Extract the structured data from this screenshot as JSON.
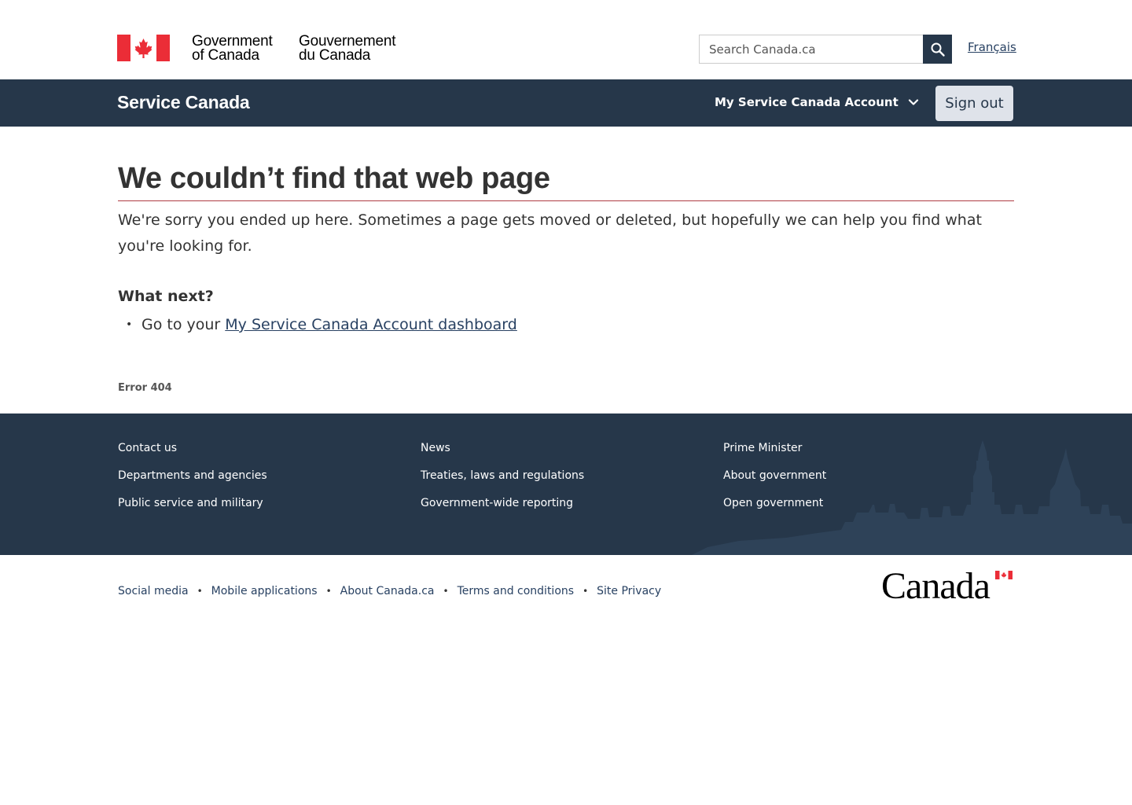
{
  "header": {
    "gov_en_line1": "Government",
    "gov_en_line2": "of Canada",
    "gov_fr_line1": "Gouvernement",
    "gov_fr_line2": "du Canada",
    "search_placeholder": "Search Canada.ca",
    "language_link": "Français"
  },
  "service_bar": {
    "title": "Service Canada",
    "account_menu": "My Service Canada Account",
    "signout_label": "Sign out"
  },
  "main": {
    "title": "We couldn’t find that web page",
    "intro": "We're sorry you ended up here. Sometimes a page gets moved or deleted, but hopefully we can help you find what you're looking for.",
    "next_heading": "What next?",
    "next_items": [
      {
        "prefix": "Go to your ",
        "link": "My Service Canada Account dashboard"
      }
    ],
    "error_code": "Error 404"
  },
  "footer": {
    "columns": [
      [
        "Contact us",
        "Departments and agencies",
        "Public service and military"
      ],
      [
        "News",
        "Treaties, laws and regulations",
        "Government-wide reporting"
      ],
      [
        "Prime Minister",
        "About government",
        "Open government"
      ]
    ]
  },
  "sub_footer": {
    "links": [
      "Social media",
      "Mobile applications",
      "About Canada.ca",
      "Terms and conditions",
      "Site Privacy"
    ],
    "separator": "•",
    "wordmark": "Canada"
  },
  "colors": {
    "brand_dark": "#26374a",
    "flag_red": "#eb2d37",
    "link": "#284162",
    "title_rule": "#af3c43"
  }
}
